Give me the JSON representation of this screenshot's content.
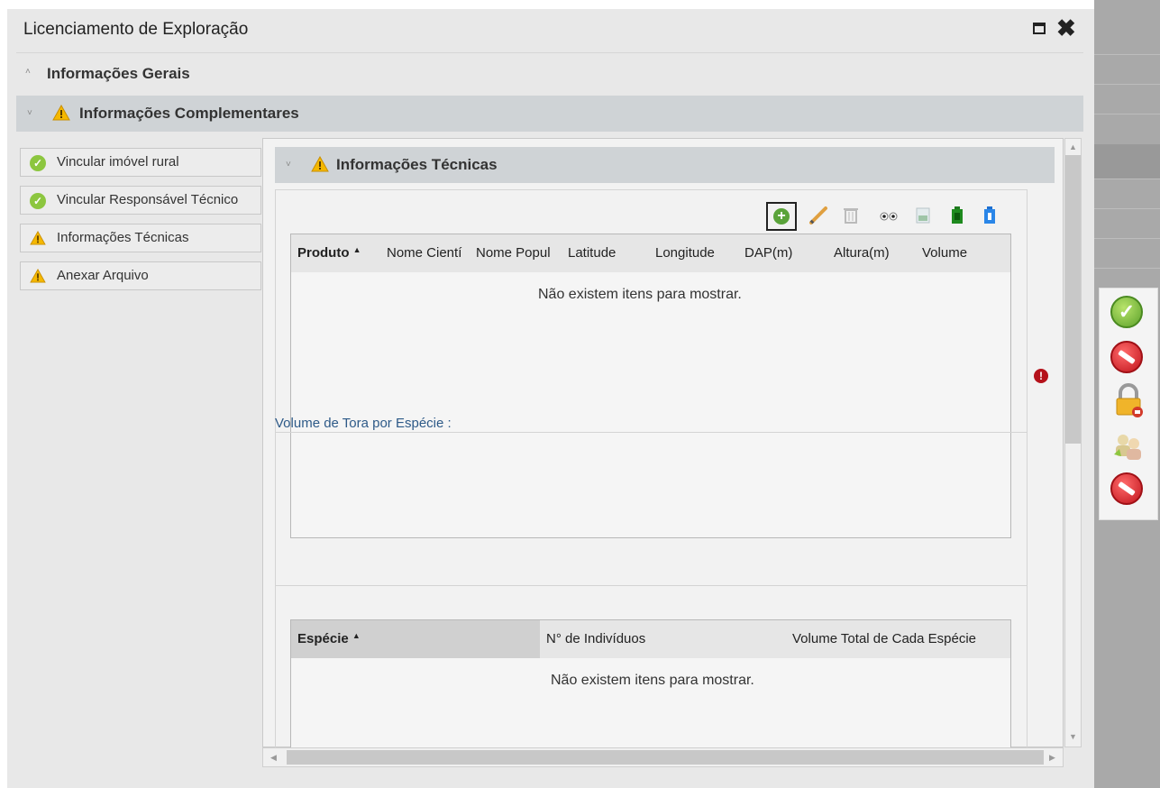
{
  "window": {
    "title": "Licenciamento de Exploração",
    "maximize_icon": "window-maximize-icon",
    "close_icon": "close-icon",
    "close_glyph": "✖"
  },
  "sections": {
    "general": {
      "label": "Informações Gerais",
      "chevron": "˄"
    },
    "complementary": {
      "label": "Informações Complementares",
      "chevron": "˅"
    }
  },
  "nav": {
    "items": [
      {
        "label": "Vincular imóvel rural",
        "status": "complete"
      },
      {
        "label": "Vincular Responsável Técnico",
        "status": "complete"
      },
      {
        "label": "Informações Técnicas",
        "status": "warning"
      },
      {
        "label": "Anexar Arquivo",
        "status": "warning"
      }
    ]
  },
  "technical": {
    "header": "Informações Técnicas",
    "chevron": "˅",
    "toolbar": [
      "add-icon",
      "edit-icon",
      "delete-icon",
      "view-icon",
      "export-icon",
      "battery-green-icon",
      "battery-blue-icon"
    ],
    "grid": {
      "columns": [
        "Produto",
        "Nome Cientí",
        "Nome Popul",
        "Latitude",
        "Longitude",
        "DAP(m)",
        "Altura(m)",
        "Volume"
      ],
      "sort_glyph": "▲",
      "empty_message": "Não existem itens para mostrar."
    }
  },
  "volume": {
    "label": "Volume de Tora por Espécie :",
    "grid": {
      "columns": [
        "Espécie",
        "N° de Indivíduos",
        "Volume Total de Cada Espécie"
      ],
      "sort_glyph": "▲",
      "empty_message": "Não existem itens para mostrar."
    }
  },
  "actions": [
    "confirm-icon",
    "cancel-icon",
    "lock-icon",
    "users-icon",
    "cancel-icon"
  ],
  "colors": {
    "section_header": "#cfd3d6",
    "warning": "#f5b800",
    "success": "#8cc63f",
    "error": "#b5121b",
    "link_label": "#2e5a88"
  }
}
